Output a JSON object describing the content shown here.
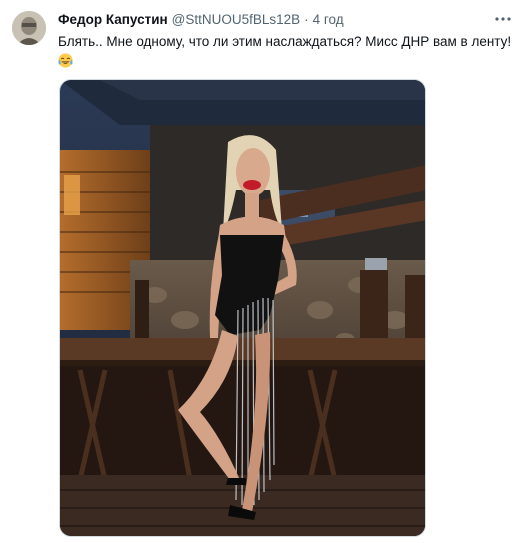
{
  "tweet": {
    "author_name": "Федор Капустин",
    "author_handle": "@SttNUOU5fBLs12B",
    "separator": "·",
    "timestamp": "4 год",
    "text": "Блять.. Мне одному, что ли этим наслаждаться? Мисс ДНР вам в ленту!",
    "emoji": "tears-of-joy-emoji",
    "more_icon": "more-horizontal-icon"
  },
  "colors": {
    "text_primary": "#0f1419",
    "text_secondary": "#536471",
    "border": "#cfd9de"
  }
}
